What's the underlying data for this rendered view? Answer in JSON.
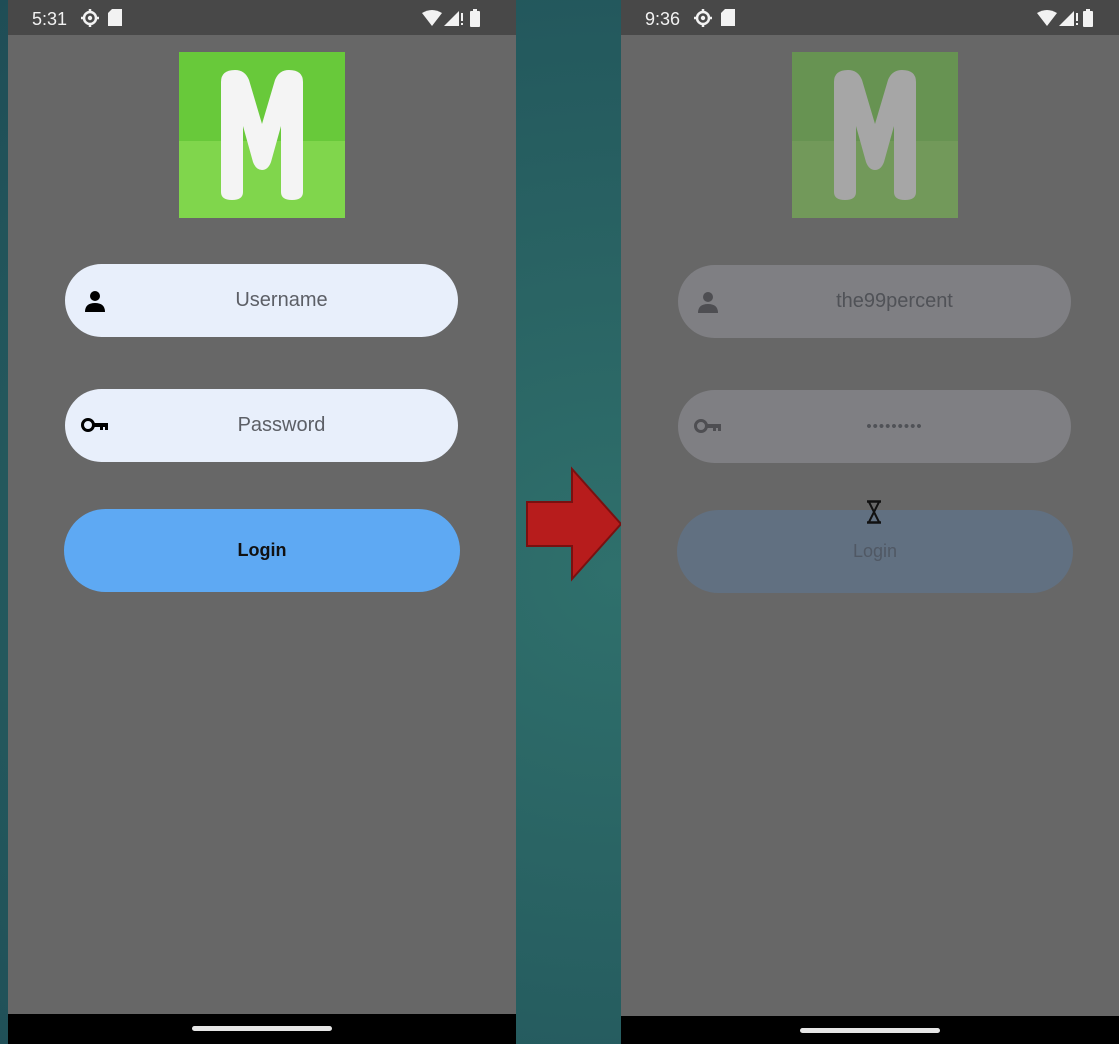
{
  "before": {
    "status": {
      "time": "5:31"
    },
    "username": {
      "placeholder": "Username"
    },
    "password": {
      "placeholder": "Password"
    },
    "login_label": "Login"
  },
  "after": {
    "status": {
      "time": "9:36"
    },
    "username": {
      "value": "the99percent"
    },
    "password": {
      "value": "•••••••••"
    },
    "login_label": "Login",
    "loading_icon": "hourglass-icon"
  },
  "logo_letter": "M",
  "colors": {
    "screen_bg": "#676767",
    "status_bar": "#484848",
    "input_bg": "#e8effb",
    "login_bg": "#5ea9f3",
    "logo_green_top": "#68c93a",
    "logo_green_bottom": "#80d64c",
    "arrow_red": "#b71c1c"
  }
}
